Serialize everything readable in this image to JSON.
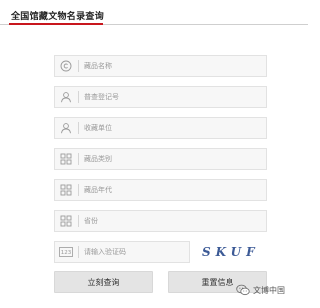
{
  "header": {
    "title": "全国馆藏文物名录查询",
    "accent_color": "#c8161d"
  },
  "form": {
    "fields": [
      {
        "placeholder": "藏品名称",
        "icon": "copyright-circle-icon"
      },
      {
        "placeholder": "普查登记号",
        "icon": "person-icon"
      },
      {
        "placeholder": "收藏单位",
        "icon": "person-icon"
      },
      {
        "placeholder": "藏品类别",
        "icon": "grid-icon"
      },
      {
        "placeholder": "藏品年代",
        "icon": "grid-icon"
      },
      {
        "placeholder": "省份",
        "icon": "grid-icon"
      }
    ],
    "captcha": {
      "placeholder": "请输入验证码",
      "icon": "captcha-123-icon",
      "icon_text": "123",
      "code": "SKUF"
    }
  },
  "buttons": {
    "query_label": "立刻查询",
    "reset_label": "重置信息"
  },
  "watermark": {
    "text": "文博中国",
    "icon": "wechat-icon"
  }
}
